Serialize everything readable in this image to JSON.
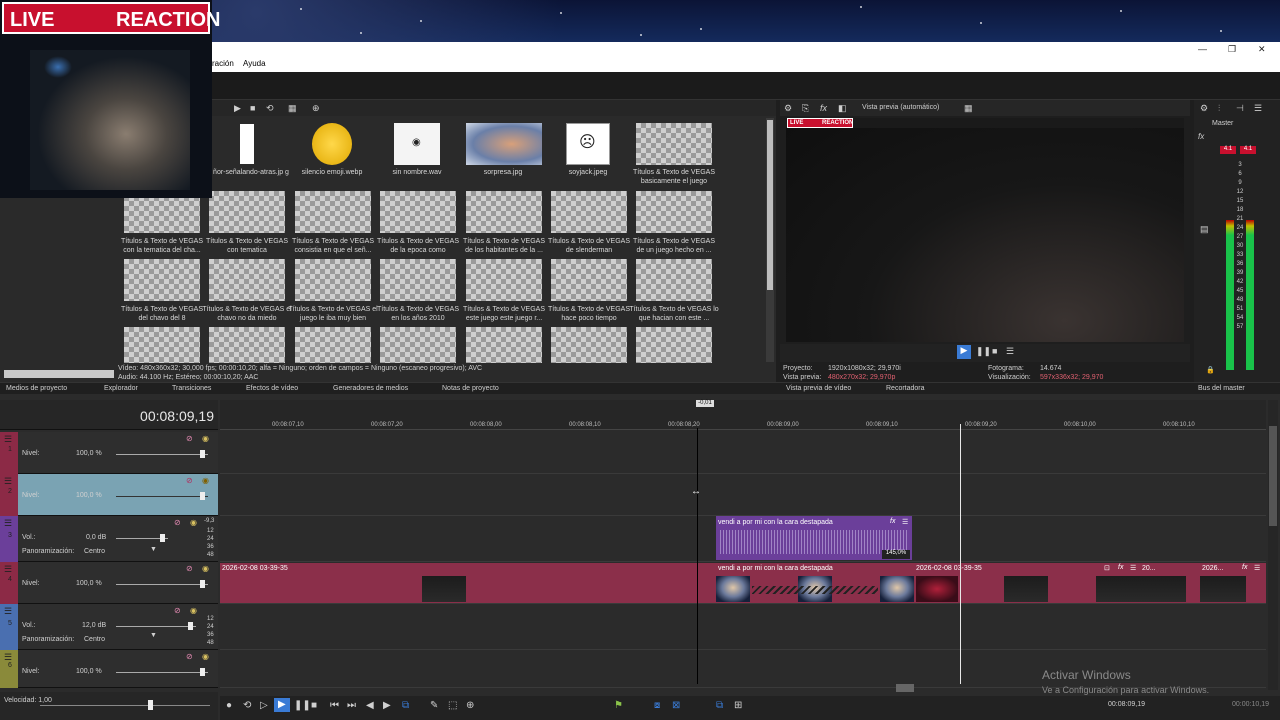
{
  "overlay": {
    "banner_left": "LIVE",
    "banner_right": "REACTION"
  },
  "menu": {
    "partial_item": "ración",
    "help": "Ayuda"
  },
  "window_controls": [
    "—",
    "❐",
    "✕"
  ],
  "media": {
    "items": [
      {
        "label": "ñor-señalando-atras.jp g"
      },
      {
        "label": "silencio emoji.webp"
      },
      {
        "label": "sin nombre.wav"
      },
      {
        "label": "sorpresa.jpg"
      },
      {
        "label": "soyjack.jpeg"
      },
      {
        "label": "Títulos & Texto de VEGAS basicamente el juego"
      },
      {
        "label": "Títulos & Texto de VEGAS con la tematica del cha..."
      },
      {
        "label": "Títulos & Texto de VEGAS con tematica"
      },
      {
        "label": "Títulos & Texto de VEGAS consistia en que el señ..."
      },
      {
        "label": "Títulos & Texto de VEGAS de la epoca como"
      },
      {
        "label": "Títulos & Texto de VEGAS de los habitantes de la ..."
      },
      {
        "label": "Títulos & Texto de VEGAS de slenderman"
      },
      {
        "label": "Títulos & Texto de VEGAS de un juego hecho en ..."
      },
      {
        "label": "Títulos & Texto de VEGAS del chavo del 8"
      },
      {
        "label": "Títulos & Texto de VEGAS el chavo no da miedo"
      },
      {
        "label": "Títulos & Texto de VEGAS el juego le iba muy bien"
      },
      {
        "label": "Títulos & Texto de VEGAS en los años 2010"
      },
      {
        "label": "Títulos & Texto de VEGAS este juego este juego r..."
      },
      {
        "label": "Títulos & Texto de VEGAS hace poco tiempo"
      },
      {
        "label": "Títulos & Texto de VEGAS lo que hacian con este ..."
      }
    ],
    "info_line1": "Vídeo: 480x360x32; 30,000 fps; 00:00:10,20; alfa = Ninguno; orden de campos = Ninguno (escaneo progresivo); AVC",
    "info_line2": "Audio: 44.100 Hz; Estéreo; 00:00:10,20; AAC"
  },
  "tabs": {
    "media": "Medios de proyecto",
    "explorer": "Explorador",
    "transitions": "Transiciones",
    "video_fx": "Efectos de vídeo",
    "generators": "Generadores de medios",
    "notes": "Notas de proyecto",
    "preview_tab": "Vista previa de vídeo",
    "trimmer": "Recortadora",
    "master_bus": "Bus del master"
  },
  "preview": {
    "mode": "Vista previa (automático)",
    "project_label": "Proyecto:",
    "project_value": "1920x1080x32; 29,970i",
    "preview_label": "Vista previa:",
    "preview_value": "480x270x32; 29,970p",
    "frame_label": "Fotograma:",
    "frame_value": "14.674",
    "display_label": "Visualización:",
    "display_value": "597x336x32; 29,970"
  },
  "master": {
    "title": "Master",
    "peak_left": "4.1",
    "peak_right": "4.1",
    "scale": [
      "3",
      "6",
      "9",
      "12",
      "15",
      "18",
      "21",
      "24",
      "27",
      "30",
      "33",
      "36",
      "39",
      "42",
      "45",
      "48",
      "51",
      "54",
      "57"
    ]
  },
  "timeline": {
    "timecode": "00:08:09,19",
    "marker_value": "-0,01",
    "ruler": [
      "00:08:07,10",
      "00:08:07,20",
      "00:08:08,00",
      "00:08:08,10",
      "00:08:08,20",
      "00:08:09,00",
      "00:08:09,10",
      "00:08:09,20",
      "00:08:10,00",
      "00:08:10,10"
    ],
    "tracks": [
      {
        "num": "1",
        "label": "Nivel:",
        "value": "100,0 %"
      },
      {
        "num": "2",
        "label": "Nivel:",
        "value": "100,0 %"
      },
      {
        "num": "3",
        "label": "Vol.:",
        "value": "0,0 dB",
        "pan_label": "Panoramización:",
        "pan_value": "Centro",
        "peak": "-9,3"
      },
      {
        "num": "4",
        "label": "Nivel:",
        "value": "100,0 %"
      },
      {
        "num": "5",
        "label": "Vol.:",
        "value": "12,0 dB",
        "pan_label": "Panoramización:",
        "pan_value": "Centro"
      },
      {
        "num": "6",
        "label": "Nivel:",
        "value": "100,0 %"
      }
    ],
    "db_scale": [
      "12",
      "24",
      "36",
      "48"
    ],
    "clips": {
      "audio_title": "vendi a por mi con la cara destapada",
      "audio_percent": "145,0%",
      "video_left": "2026-02-08 03-39-35",
      "video_mid": "vendi a por mi con la cara destapada",
      "video_right": "2026-02-08 03-39-35",
      "video_tail1": "20...",
      "video_tail2": "2026..."
    },
    "speed": "Velocidad: 1,00",
    "bottom_time": "00:08:09,19",
    "bottom_time2": "00:00:10,19"
  },
  "watermark": {
    "line1": "Activar Windows",
    "line2": "Ve a Configuración para activar Windows."
  }
}
